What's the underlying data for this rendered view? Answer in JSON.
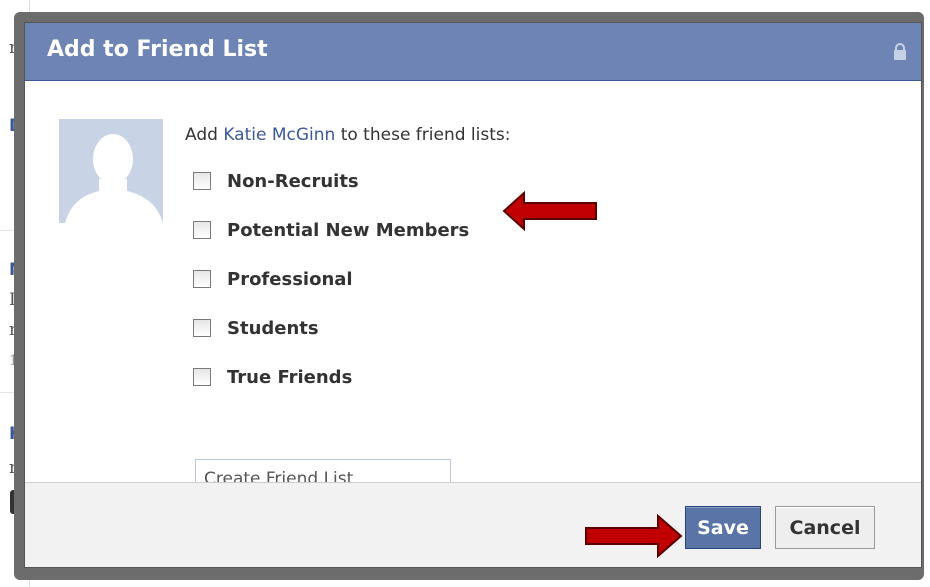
{
  "dialog": {
    "title": "Add to Friend List",
    "lock_icon": "lock-icon"
  },
  "intro": {
    "prefix": "Add ",
    "name": "Katie McGinn",
    "suffix": " to these friend lists:"
  },
  "friend_lists": [
    {
      "label": "Non-Recruits",
      "checked": false
    },
    {
      "label": "Potential New Members",
      "checked": false
    },
    {
      "label": "Professional",
      "checked": false
    },
    {
      "label": "Students",
      "checked": false
    },
    {
      "label": "True Friends",
      "checked": false
    }
  ],
  "create_list": {
    "placeholder": "Create Friend List"
  },
  "buttons": {
    "save": "Save",
    "cancel": "Cancel"
  },
  "colors": {
    "header": "#6d84b4",
    "link": "#3b5998",
    "arrow": "#c00000"
  }
}
